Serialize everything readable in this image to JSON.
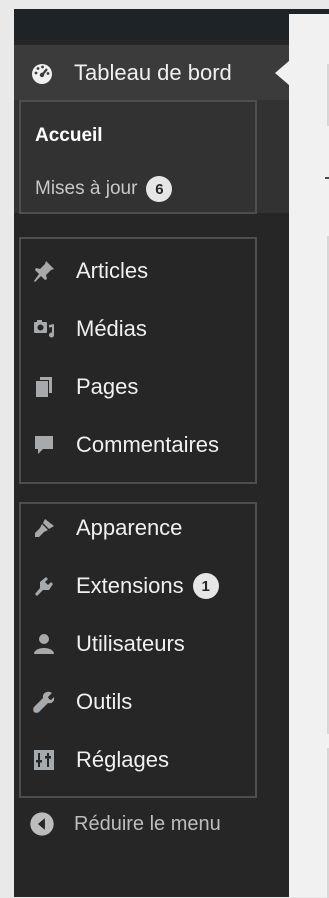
{
  "menu": {
    "dashboard": {
      "label": "Tableau de bord",
      "icon": "dashboard-icon"
    },
    "submenu": {
      "home": "Accueil",
      "updates": "Mises à jour",
      "updates_count": "6"
    },
    "group1": [
      {
        "label": "Articles",
        "icon": "pushpin-icon"
      },
      {
        "label": "Médias",
        "icon": "media-icon"
      },
      {
        "label": "Pages",
        "icon": "pages-icon"
      },
      {
        "label": "Commentaires",
        "icon": "comment-icon"
      }
    ],
    "group2": [
      {
        "label": "Apparence",
        "icon": "paintbrush-icon"
      },
      {
        "label": "Extensions",
        "icon": "plugin-icon",
        "badge": "1"
      },
      {
        "label": "Utilisateurs",
        "icon": "user-icon"
      },
      {
        "label": "Outils",
        "icon": "wrench-icon"
      },
      {
        "label": "Réglages",
        "icon": "settings-icon"
      }
    ],
    "collapse": {
      "label": "Réduire le menu",
      "icon": "collapse-icon"
    }
  },
  "colors": {
    "sidebar_bg": "#262626",
    "active_bg": "#3b3b3b",
    "text": "#f0f0f1",
    "badge_bg": "#e6e6e6"
  }
}
